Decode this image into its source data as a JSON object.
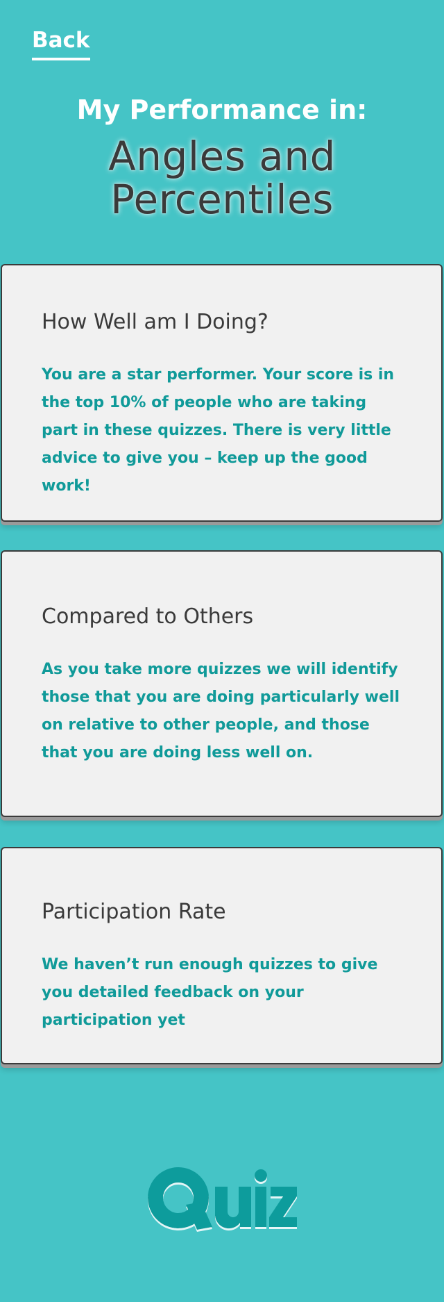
{
  "nav": {
    "back_label": "Back"
  },
  "header": {
    "performance_label": "My Performance in:",
    "quiz_title": "Angles and Percentiles"
  },
  "cards": [
    {
      "title": "How Well am I Doing?",
      "body": "You are a star performer. Your score is in the top 10% of people who are taking part in these quizzes. There is very little advice to give you – keep up the good work!"
    },
    {
      "title": "Compared to Others",
      "body": "As you take more quizzes we will identify those that you are doing particularly well on relative to other people, and those that you are doing less well on."
    },
    {
      "title": "Participation Rate",
      "body": "We haven’t run enough quizzes to give you detailed feedback on your participation yet"
    }
  ],
  "logo": {
    "text": "Quiz"
  },
  "colors": {
    "background": "#45c4c6",
    "card_background": "#f1f1f1",
    "card_border": "#3b3b3b",
    "accent_text": "#109a99",
    "heading_text": "#3a3a3a",
    "logo": "#0e9c9c"
  }
}
